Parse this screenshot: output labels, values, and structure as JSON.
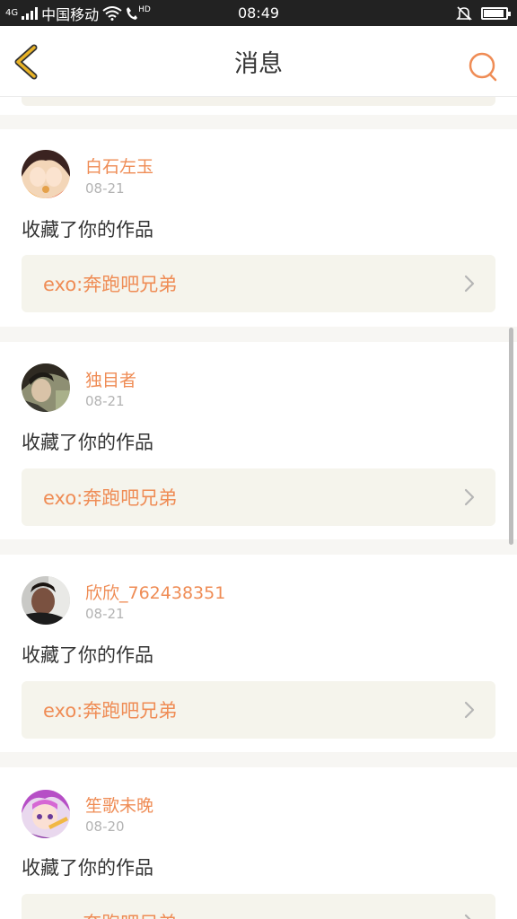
{
  "status_bar": {
    "network": "4G",
    "carrier": "中国移动",
    "hd": "HD",
    "time": "08:49"
  },
  "header": {
    "title": "消息",
    "back_icon": "chevron-left-icon",
    "search_icon": "search-icon"
  },
  "colors": {
    "accent": "#ef8c55",
    "back_yellow": "#e9b326",
    "link_bg": "#f5f4ec"
  },
  "messages": [
    {
      "username": "白石左玉",
      "date": "08-21",
      "action": "收藏了你的作品",
      "work": "exo:奔跑吧兄弟"
    },
    {
      "username": "独目者",
      "date": "08-21",
      "action": "收藏了你的作品",
      "work": "exo:奔跑吧兄弟"
    },
    {
      "username": "欣欣_762438351",
      "date": "08-21",
      "action": "收藏了你的作品",
      "work": "exo:奔跑吧兄弟"
    },
    {
      "username": "笙歌未晚",
      "date": "08-20",
      "action": "收藏了你的作品",
      "work": "exo:奔跑吧兄弟"
    }
  ]
}
